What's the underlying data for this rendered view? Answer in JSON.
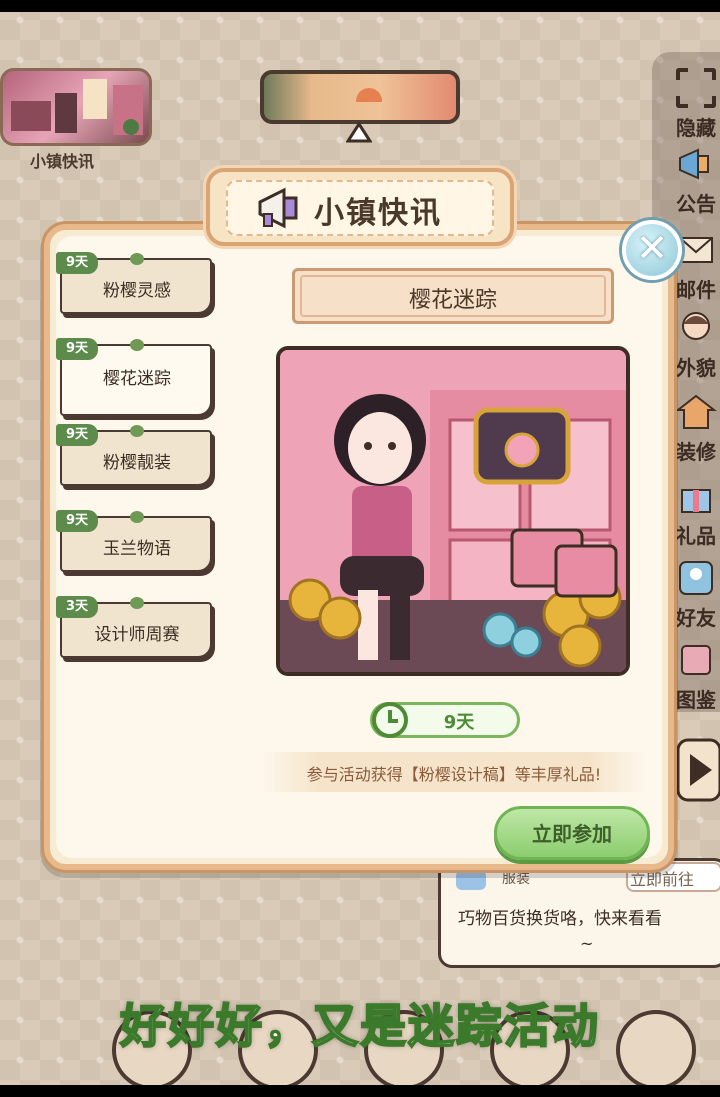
{
  "news_panel": {
    "label": "小镇快讯"
  },
  "sidebar": {
    "items": [
      {
        "label": "隐藏",
        "icon": "hide-icon"
      },
      {
        "label": "公告",
        "icon": "announcement-icon"
      },
      {
        "label": "邮件",
        "icon": "mail-icon"
      },
      {
        "label": "外貌",
        "icon": "appearance-icon"
      },
      {
        "label": "装修",
        "icon": "decoration-icon"
      },
      {
        "label": "礼品",
        "icon": "gift-icon"
      },
      {
        "label": "好友",
        "icon": "friends-icon"
      },
      {
        "label": "图鉴",
        "icon": "collection-icon"
      }
    ]
  },
  "modal": {
    "title": "小镇快讯",
    "close_label": "✕",
    "events": [
      {
        "badge": "9天",
        "label": "粉樱灵感"
      },
      {
        "badge": "9天",
        "label": "樱花迷踪"
      },
      {
        "badge": "9天",
        "label": "粉樱靓装"
      },
      {
        "badge": "9天",
        "label": "玉兰物语"
      },
      {
        "badge": "3天",
        "label": "设计师周赛"
      }
    ],
    "selected_title": "樱花迷踪",
    "timer": "9天",
    "description": "参与活动获得【粉樱设计稿】等丰厚礼品!",
    "join_button": "立即参加"
  },
  "notice": {
    "label": "服装",
    "go_button": "立即前往",
    "text": "巧物百货换货咯，快来看看",
    "tilde": "~"
  },
  "caption": "好好好，又是迷踪活动",
  "colors": {
    "accent_green": "#8ccd6e",
    "badge_green": "#5c8b4c",
    "modal_bg": "#fdf7ec",
    "border_brown": "#4c3a32"
  }
}
